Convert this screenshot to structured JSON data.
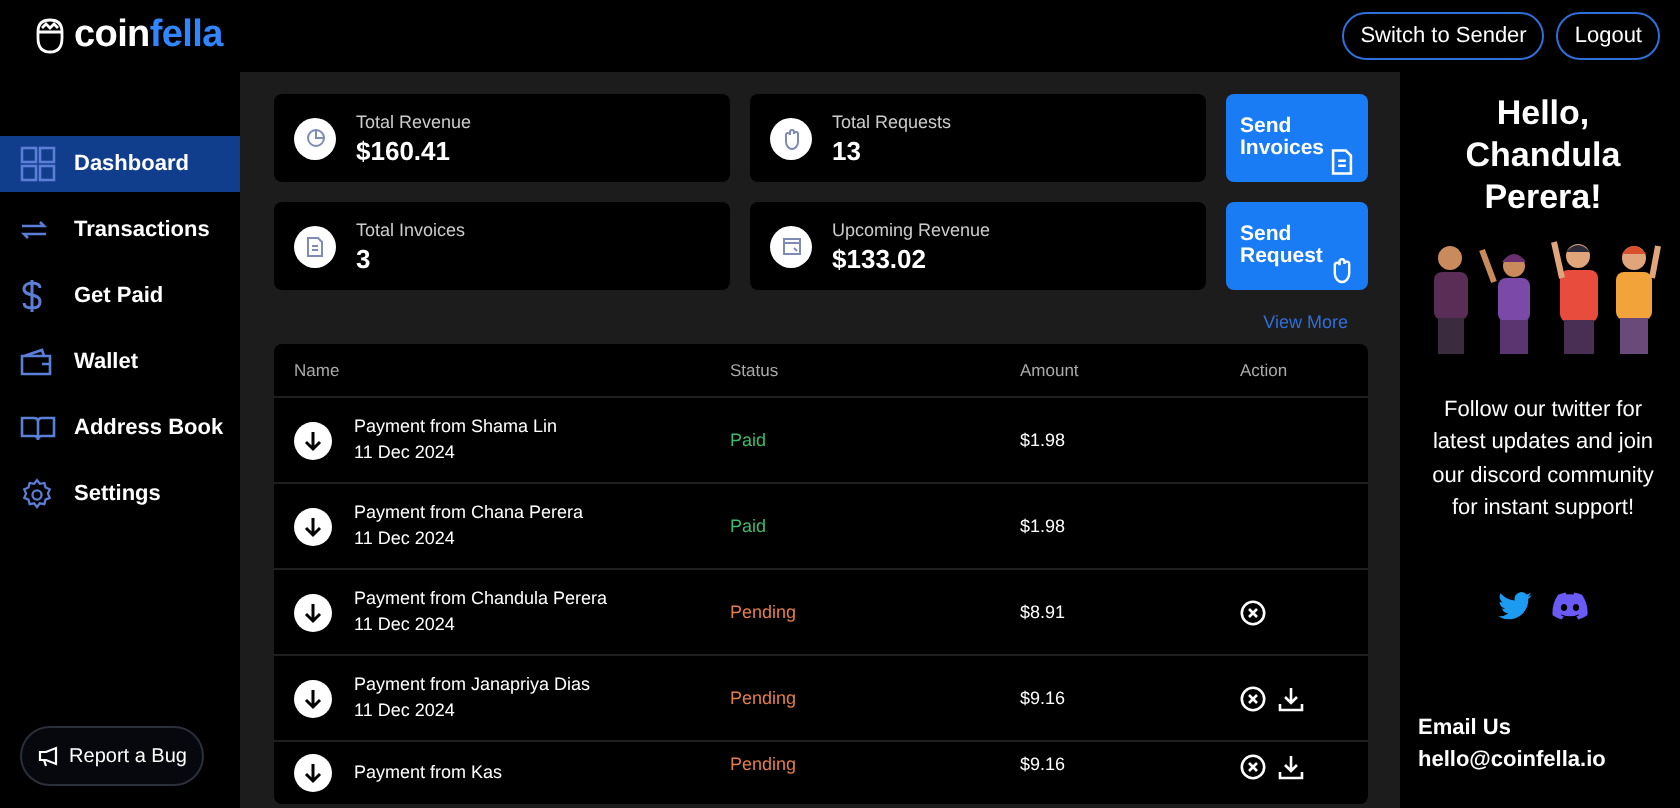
{
  "brand": {
    "part_1": "coin",
    "part_2": "fella"
  },
  "header": {
    "buttons": [
      "Switch to Sender",
      "Logout"
    ]
  },
  "sidebar": {
    "items": [
      {
        "label": "Dashboard",
        "selected": true
      },
      {
        "label": "Transactions",
        "selected": false
      },
      {
        "label": "Get Paid",
        "selected": false
      },
      {
        "label": "Wallet",
        "selected": false
      },
      {
        "label": "Address Book",
        "selected": false
      },
      {
        "label": "Settings",
        "selected": false
      }
    ],
    "report_button": "Report a Bug"
  },
  "stats": [
    {
      "label": "Total Revenue",
      "value": "$160.41"
    },
    {
      "label": "Total Requests",
      "value": "13"
    },
    {
      "label": "Total Invoices",
      "value": "3"
    },
    {
      "label": "Upcoming Revenue",
      "value": "$133.02"
    }
  ],
  "actions": [
    {
      "label": "Send Invoices"
    },
    {
      "label": "Send Request"
    }
  ],
  "view_more": "View More",
  "table": {
    "columns": [
      "Name",
      "Status",
      "Amount",
      "Action"
    ],
    "rows": [
      {
        "name": "Payment from Shama Lin",
        "date": "11 Dec 2024",
        "status": {
          "text": "Paid",
          "kind": "paid"
        },
        "amount": "$1.98",
        "actions": []
      },
      {
        "name": "Payment from Chana Perera",
        "date": "11 Dec 2024",
        "status": {
          "text": "Paid",
          "kind": "paid"
        },
        "amount": "$1.98",
        "actions": []
      },
      {
        "name": "Payment from Chandula Perera",
        "date": "11 Dec 2024",
        "status": {
          "text": "Pending",
          "kind": "pending"
        },
        "amount": "$8.91",
        "actions": [
          {
            "kind": "cancel"
          }
        ]
      },
      {
        "name": "Payment from Janapriya Dias",
        "date": "11 Dec 2024",
        "status": {
          "text": "Pending",
          "kind": "pending"
        },
        "amount": "$9.16",
        "actions": [
          {
            "kind": "cancel"
          },
          {
            "kind": "download"
          }
        ]
      },
      {
        "name": "Payment from Kas",
        "status": {
          "text": "Pending",
          "kind": "pending"
        },
        "amount": "$9.16",
        "actions": [
          {
            "kind": "cancel"
          },
          {
            "kind": "download"
          }
        ]
      }
    ]
  },
  "panel": {
    "greeting": "Hello, Chandula Perera!",
    "message": "Follow our twitter for latest updates and join our discord community for instant support!",
    "email_label": "Email Us",
    "email": "hello@coinfella.io"
  }
}
